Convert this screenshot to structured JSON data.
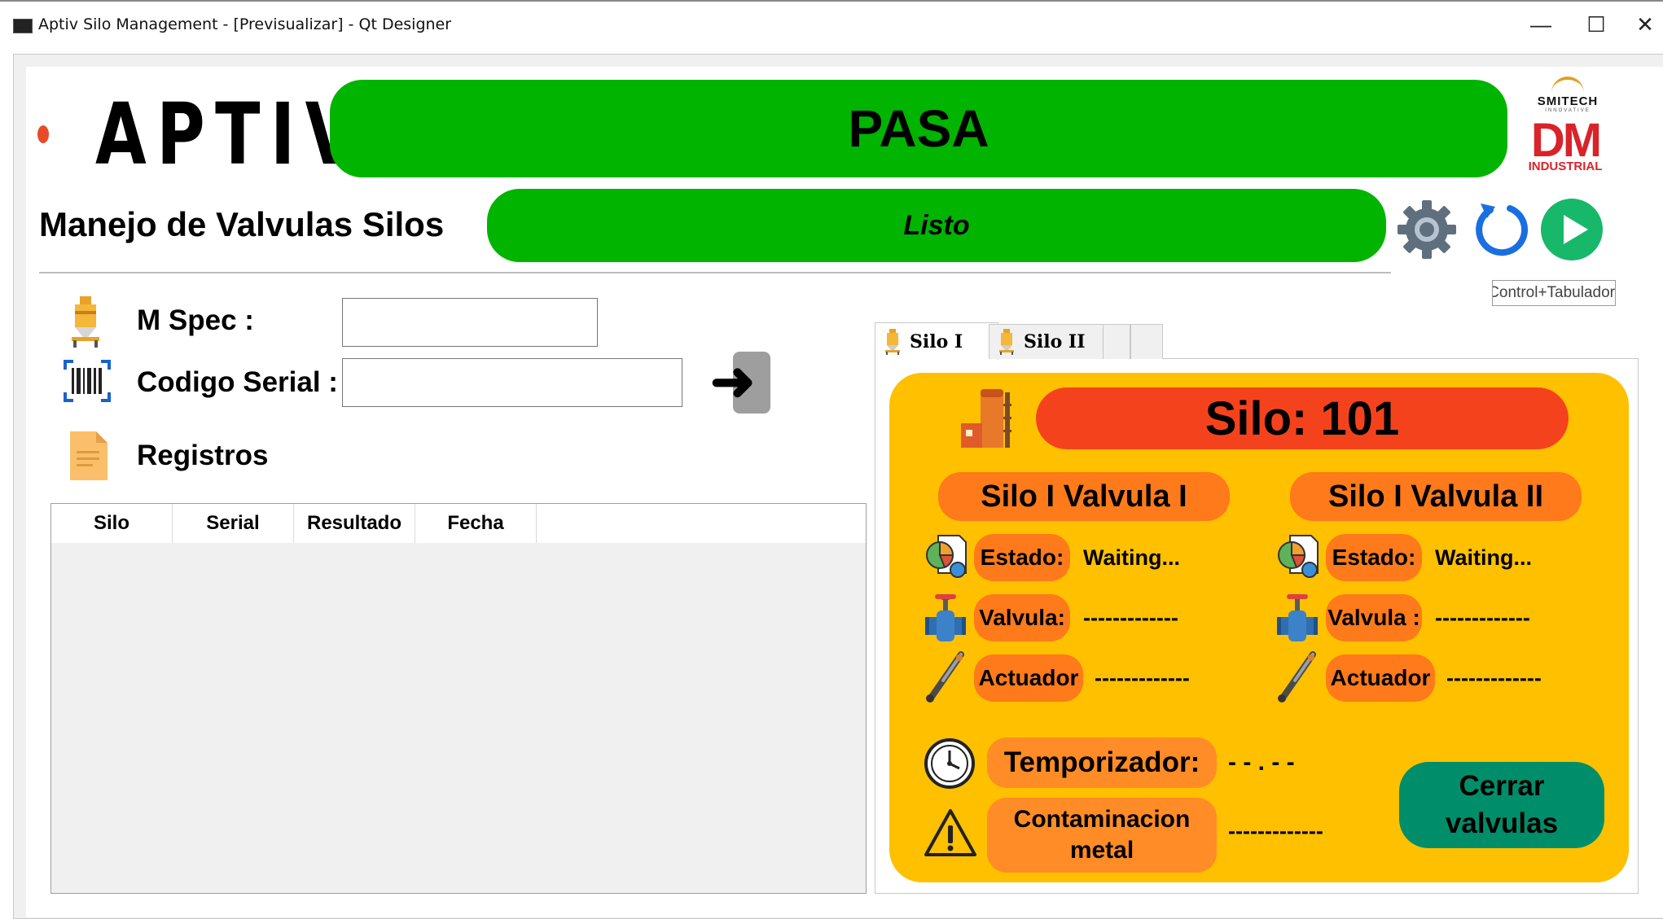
{
  "window": {
    "title": "Aptiv Silo Management - [Previsualizar] - Qt Designer",
    "minimize": "—",
    "maximize": "☐",
    "close": "✕"
  },
  "header": {
    "logo_text": "APTIV",
    "status_main": "PASA",
    "status_sub": "Listo",
    "subtitle": "Manejo de Valvulas Silos",
    "smitech": "SMITECH",
    "smitech_tag": "INNOVATIVE",
    "dm": "DM",
    "dm_sub": "INDUSTRIAL",
    "shortcut": "Control+Tabulador",
    "icons": [
      "gear-icon",
      "refresh-icon",
      "play-icon"
    ]
  },
  "form": {
    "mspec_label": "M Spec :",
    "mspec_value": "",
    "serial_label": "Codigo Serial :",
    "serial_value": "",
    "submit_glyph": "➜",
    "records_label": "Registros"
  },
  "table": {
    "columns": [
      "Silo",
      "Serial",
      "Resultado",
      "Fecha"
    ],
    "rows": []
  },
  "tabs": [
    {
      "label": "Silo I",
      "active": true
    },
    {
      "label": "Silo II",
      "active": false
    }
  ],
  "silo": {
    "title": "Silo: 101",
    "valve1": {
      "title": "Silo I Valvula I",
      "estado_label": "Estado:",
      "estado_value": "Waiting...",
      "valvula_label": "Valvula:",
      "valvula_value": "-------------",
      "actuador_label": "Actuador",
      "actuador_value": "-------------"
    },
    "valve2": {
      "title": "Silo I Valvula II",
      "estado_label": "Estado:",
      "estado_value": "Waiting...",
      "valvula_label": "Valvula :",
      "valvula_value": "-------------",
      "actuador_label": "Actuador",
      "actuador_value": "-------------"
    },
    "timer_label": "Temporizador:",
    "timer_value": "- - . - -",
    "contam_label_1": "Contaminacion",
    "contam_label_2": "metal",
    "contam_value": "-------------",
    "close_line1": "Cerrar",
    "close_line2": "valvulas"
  },
  "colors": {
    "status_green": "#00b400",
    "panel_yellow": "#ffc000",
    "title_red": "#f4431c",
    "label_orange": "#ff7a1a",
    "close_teal": "#008e6a"
  }
}
